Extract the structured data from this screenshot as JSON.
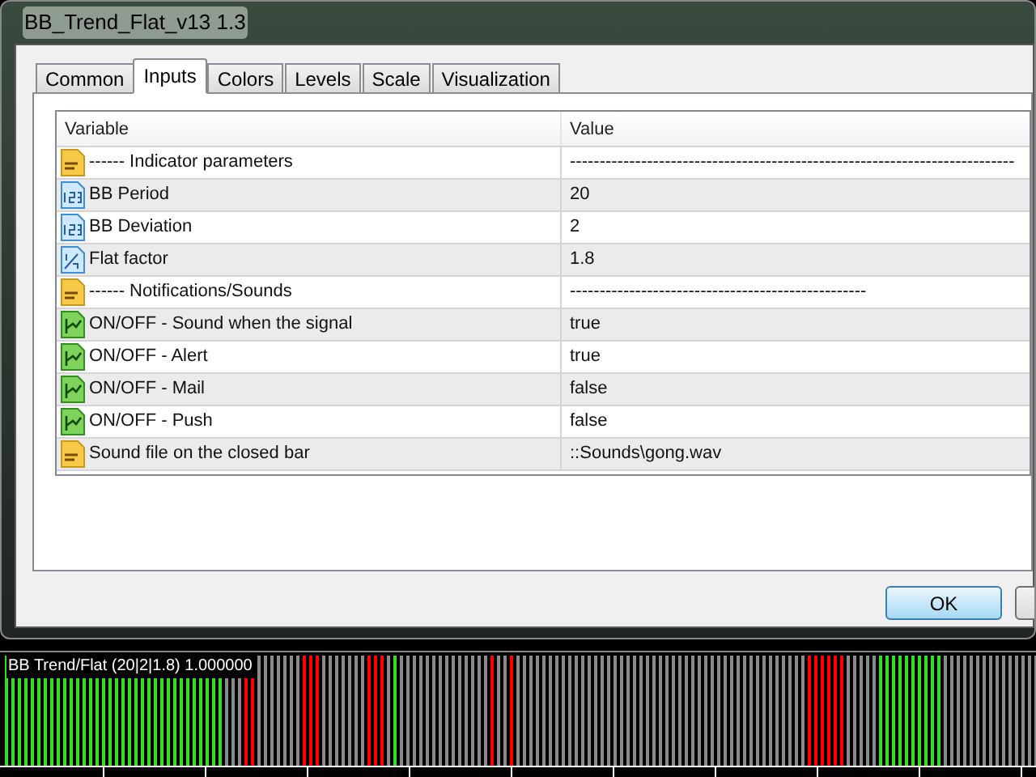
{
  "window": {
    "title": "BB_Trend_Flat_v13 1.3"
  },
  "tabs": [
    {
      "label": "Common",
      "selected": false
    },
    {
      "label": "Inputs",
      "selected": true
    },
    {
      "label": "Colors",
      "selected": false
    },
    {
      "label": "Levels",
      "selected": false
    },
    {
      "label": "Scale",
      "selected": false
    },
    {
      "label": "Visualization",
      "selected": false
    }
  ],
  "table": {
    "columns": [
      "Variable",
      "Value"
    ],
    "rows": [
      {
        "kind": "string",
        "variable": "------ Indicator parameters",
        "value": "---------------------------------------------------------------------------"
      },
      {
        "kind": "integer",
        "variable": "BB Period",
        "value": "20"
      },
      {
        "kind": "integer",
        "variable": "BB Deviation",
        "value": "2"
      },
      {
        "kind": "double",
        "variable": "Flat factor",
        "value": "1.8"
      },
      {
        "kind": "string",
        "variable": "------ Notifications/Sounds",
        "value": "--------------------------------------------------"
      },
      {
        "kind": "bool",
        "variable": "ON/OFF - Sound when the signal",
        "value": "true"
      },
      {
        "kind": "bool",
        "variable": "ON/OFF - Alert",
        "value": "true"
      },
      {
        "kind": "bool",
        "variable": "ON/OFF - Mail",
        "value": "false"
      },
      {
        "kind": "bool",
        "variable": "ON/OFF - Push",
        "value": "false"
      },
      {
        "kind": "string",
        "variable": "Sound file on the closed bar",
        "value": "::Sounds\\gong.wav"
      }
    ]
  },
  "buttons": [
    "OK"
  ],
  "indicator": {
    "label": "BB Trend/Flat (20|2|1.8) 1.000000"
  }
}
